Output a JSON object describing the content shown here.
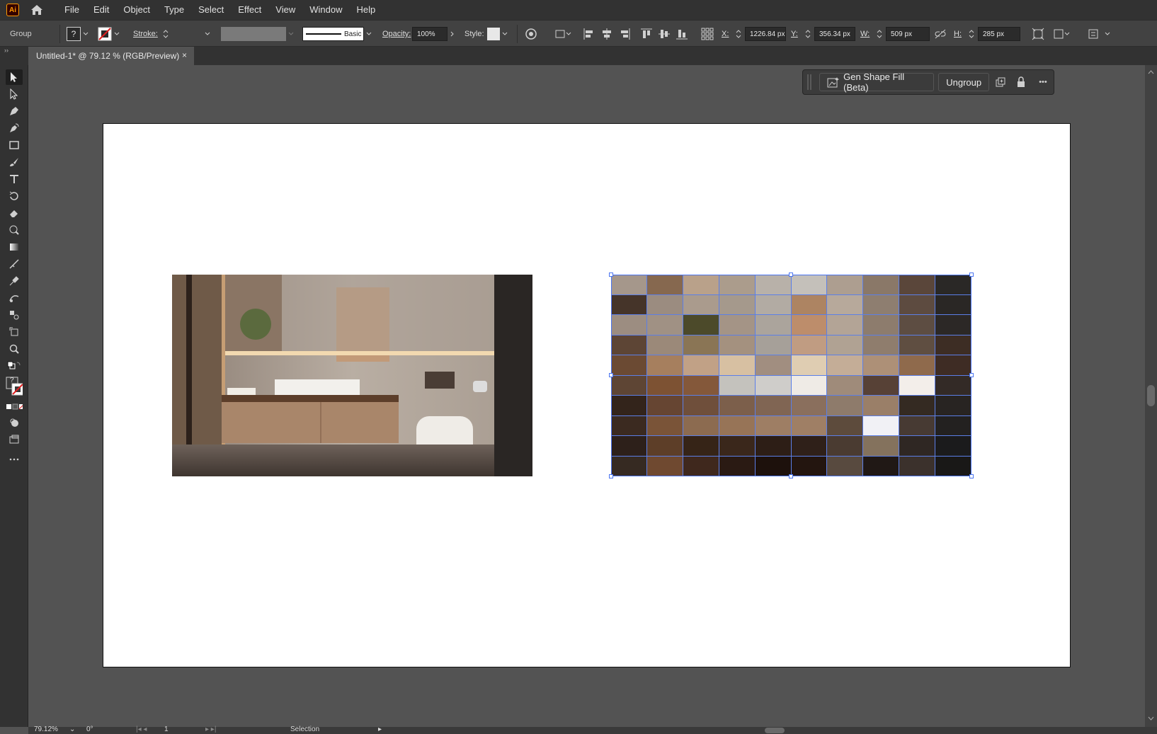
{
  "app": {
    "logo_text": "Ai"
  },
  "menu": [
    "File",
    "Edit",
    "Object",
    "Type",
    "Select",
    "Effect",
    "View",
    "Window",
    "Help"
  ],
  "control_bar": {
    "selection_type": "Group",
    "fill_unknown": "?",
    "stroke_label": "Stroke:",
    "stroke_profile": "Basic",
    "opacity_label": "Opacity:",
    "opacity_value": "100%",
    "style_label": "Style:",
    "x_label": "X:",
    "x_value": "1226.84 px",
    "y_label": "Y:",
    "y_value": "356.34 px",
    "w_label": "W:",
    "w_value": "509 px",
    "h_label": "H:",
    "h_value": "285 px"
  },
  "document_tab": {
    "title": "Untitled-1* @ 79.12 % (RGB/Preview)",
    "close": "×"
  },
  "task_bar": {
    "gen_fill_label": "Gen Shape Fill (Beta)",
    "ungroup_label": "Ungroup",
    "more": "•••"
  },
  "status_bar": {
    "zoom": "79.12%",
    "rotation": "0°",
    "artboard": "1",
    "tool": "Selection"
  },
  "toolbar_fill_unknown": "?",
  "icons": {
    "home": "home-icon",
    "selection": "selection-tool-icon",
    "direct": "direct-selection-icon",
    "pen": "pen-icon",
    "curvature": "curvature-icon",
    "rect": "rectangle-icon",
    "brush": "paintbrush-icon",
    "type": "type-icon",
    "rotate": "rotate-icon",
    "eraser": "eraser-icon",
    "lasso": "lasso-icon",
    "gradient": "gradient-icon",
    "eyedropper": "eyedropper-icon",
    "zoom": "zoom-icon"
  },
  "mosaic_colors": [
    [
      "#a5978b",
      "#86684f",
      "#b9a18a",
      "#ab9c8c",
      "#b8b1a9",
      "#c4c0ba",
      "#ad9e90",
      "#8a7868",
      "#5a463a",
      "#2a2826"
    ],
    [
      "#453429",
      "#9b8c80",
      "#aa9b8d",
      "#a5998c",
      "#b2aba3",
      "#ad8462",
      "#b7a99b",
      "#8e7e70",
      "#5d4b40",
      "#2a2725"
    ],
    [
      "#9c8d81",
      "#a09184",
      "#4c4a2a",
      "#a49486",
      "#aba49c",
      "#bd8d6b",
      "#b3a496",
      "#8d7c6d",
      "#5d4d42",
      "#2c2826"
    ],
    [
      "#5d4535",
      "#9b8979",
      "#8a7555",
      "#a4917f",
      "#a6a099",
      "#c09c82",
      "#b0a293",
      "#8f7d6d",
      "#5f4e41",
      "#3d2d24"
    ],
    [
      "#6b4a33",
      "#a67f5e",
      "#c1a186",
      "#d7c0a2",
      "#a18e80",
      "#dfcdb2",
      "#c4ad97",
      "#ad9077",
      "#8f6a4c",
      "#3e2c24"
    ],
    [
      "#5e4534",
      "#7d5233",
      "#84583a",
      "#c4c2bd",
      "#cfcdca",
      "#efebe6",
      "#9f8b7a",
      "#574136",
      "#f3eeea",
      "#332a26"
    ],
    [
      "#33241b",
      "#664532",
      "#6f4f3b",
      "#7c5f4b",
      "#806553",
      "#8a6f5d",
      "#8e7b6b",
      "#9a7f68",
      "#342a22",
      "#282422"
    ],
    [
      "#3b2a20",
      "#7a5438",
      "#8c6b50",
      "#977457",
      "#9e7e64",
      "#9f7f65",
      "#5d4b3c",
      "#f1f1f5",
      "#473a33",
      "#232120"
    ],
    [
      "#2d201a",
      "#5d3e28",
      "#362417",
      "#3a271b",
      "#2d1e16",
      "#2f2019",
      "#4a3b31",
      "#84725d",
      "#2f2723",
      "#1b1b1c"
    ],
    [
      "#362a22",
      "#6f4930",
      "#3f281d",
      "#2a1a13",
      "#1d110c",
      "#23150f",
      "#584a3f",
      "#201815",
      "#3b312c",
      "#191817"
    ]
  ]
}
